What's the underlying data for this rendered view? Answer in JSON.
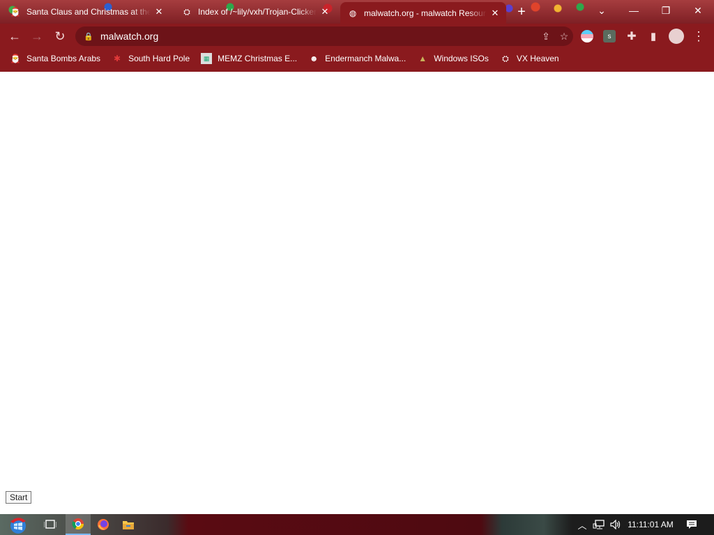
{
  "tabs": [
    {
      "title": "Santa Claus and Christmas at the",
      "favicon": "santa-icon",
      "active": false
    },
    {
      "title": "Index of /~lily/vxh/Trojan-Clicker",
      "favicon": "vxheaven-icon",
      "active": false
    },
    {
      "title": "malwatch.org - malwatch Resour",
      "favicon": "globe-icon",
      "active": true
    }
  ],
  "new_tab_label": "+",
  "address": {
    "url": "malwatch.org"
  },
  "bookmarks": [
    {
      "label": "Santa Bombs Arabs",
      "icon": "santa-icon"
    },
    {
      "label": "South Hard Pole",
      "icon": "snowflake-icon"
    },
    {
      "label": "MEMZ Christmas E...",
      "icon": "memz-icon"
    },
    {
      "label": "Endermanch Malwa...",
      "icon": "endermanch-icon"
    },
    {
      "label": "Windows ISOs",
      "icon": "tree-icon"
    },
    {
      "label": "VX Heaven",
      "icon": "vxheaven-icon"
    }
  ],
  "extensions": [
    {
      "name": "flag-extension-icon"
    },
    {
      "name": "s-extension-icon",
      "letter": "s"
    }
  ],
  "tooltip": "Start",
  "taskbar": {
    "clock": "11:11:01 AM",
    "apps": [
      "start-button",
      "task-view-icon",
      "chrome-icon",
      "firefox-icon",
      "file-explorer-icon"
    ]
  },
  "colors": {
    "chrome_frame": "#8a1a1e",
    "taskbar_accent": "#5a0b12"
  }
}
